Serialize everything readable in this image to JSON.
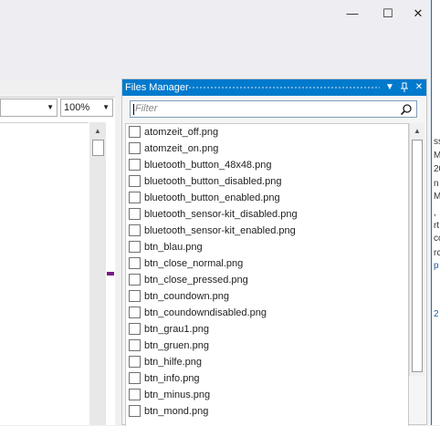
{
  "window": {
    "minimize_glyph": "—",
    "maximize_glyph": "☐",
    "close_glyph": "✕"
  },
  "left": {
    "zoom_value": "100%",
    "dropdown_glyph": "▼",
    "scroll_up_glyph": "▲"
  },
  "panel": {
    "title": "Files Manager",
    "dropdown_glyph": "▼",
    "pin_glyph": "🖈",
    "close_glyph": "✕",
    "filter_placeholder": "Filter",
    "items": [
      "atomzeit_off.png",
      "atomzeit_on.png",
      "bluetooth_button_48x48.png",
      "bluetooth_button_disabled.png",
      "bluetooth_button_enabled.png",
      "bluetooth_sensor-kit_disabled.png",
      "bluetooth_sensor-kit_enabled.png",
      "btn_blau.png",
      "btn_close_normal.png",
      "btn_close_pressed.png",
      "btn_coundown.png",
      "btn_coundowndisabled.png",
      "btn_grau1.png",
      "btn_gruen.png",
      "btn_hilfe.png",
      "btn_info.png",
      "btn_minus.png",
      "btn_mond.png"
    ],
    "scroll_up_glyph": "▲"
  },
  "right_strip": [
    {
      "text": "ss",
      "blue": false
    },
    {
      "text": "Mi",
      "blue": false
    },
    {
      "text": "20",
      "blue": false
    },
    {
      "text": "n",
      "blue": false
    },
    {
      "text": "Ma",
      "blue": false
    },
    {
      "text": ",",
      "blue": false
    },
    {
      "text": "rt",
      "blue": false
    },
    {
      "text": "cc",
      "blue": false
    },
    {
      "text": "rc",
      "blue": false
    },
    {
      "text": "p",
      "blue": true
    },
    {
      "text": "2",
      "blue": true
    }
  ]
}
